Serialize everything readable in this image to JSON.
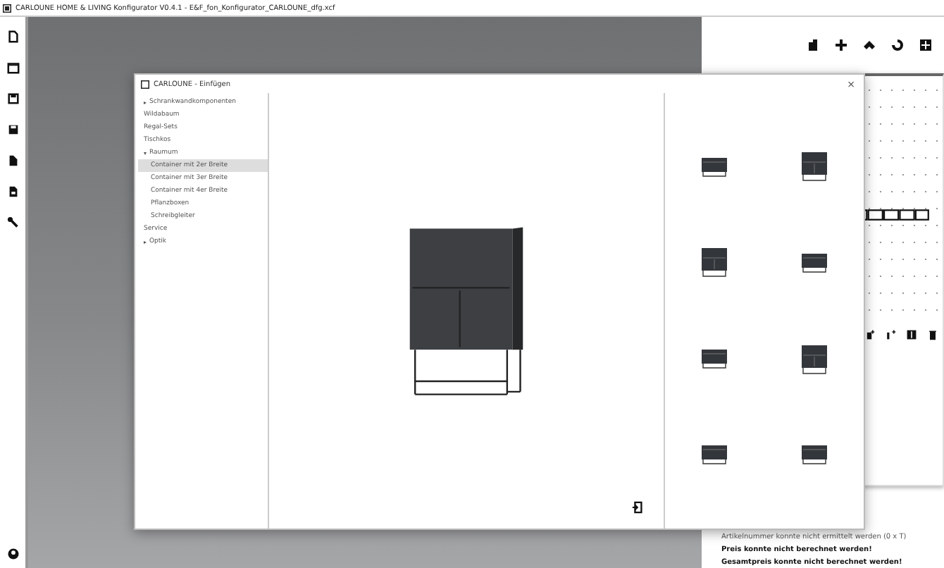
{
  "window": {
    "title": "CARLOUNE HOME & LIVING Konfigurator V0.4.1 - E&F_fon_Konfigurator_CARLOUNE_dfg.xcf"
  },
  "dialog": {
    "title": "CARLOUNE - Einfügen",
    "close": "×",
    "tree": [
      {
        "label": "Schrankwandkomponenten",
        "expanded": false,
        "selected": false
      },
      {
        "label": "Wildabaum",
        "selected": false
      },
      {
        "label": "Regal-Sets",
        "selected": false
      },
      {
        "label": "Tischkos",
        "selected": false
      },
      {
        "label": "Raumum",
        "expanded": true,
        "selected": false,
        "children": [
          {
            "label": "Container mit 2er Breite",
            "selected": true
          },
          {
            "label": "Container mit 3er Breite",
            "selected": false
          },
          {
            "label": "Container mit 4er Breite",
            "selected": false
          },
          {
            "label": "Pflanzboxen",
            "selected": false
          },
          {
            "label": "Schreibgleiter",
            "selected": false
          }
        ]
      },
      {
        "label": "Service",
        "selected": false
      },
      {
        "label": "Optik",
        "expanded": false,
        "selected": false
      }
    ],
    "thumbnails": [
      {
        "kind": "low"
      },
      {
        "kind": "tall"
      },
      {
        "kind": "tall"
      },
      {
        "kind": "low"
      },
      {
        "kind": "low"
      },
      {
        "kind": "tall"
      },
      {
        "kind": "low"
      },
      {
        "kind": "low"
      }
    ]
  },
  "status_lines": [
    {
      "text": "Artikelnummer konnte nicht ermittelt werden (0 x T)",
      "kind": "info"
    },
    {
      "text": "Preis konnte nicht berechnet werden!",
      "kind": "warning"
    },
    {
      "text": "Gesamtpreis konnte nicht berechnet werden!",
      "kind": "warning"
    }
  ]
}
